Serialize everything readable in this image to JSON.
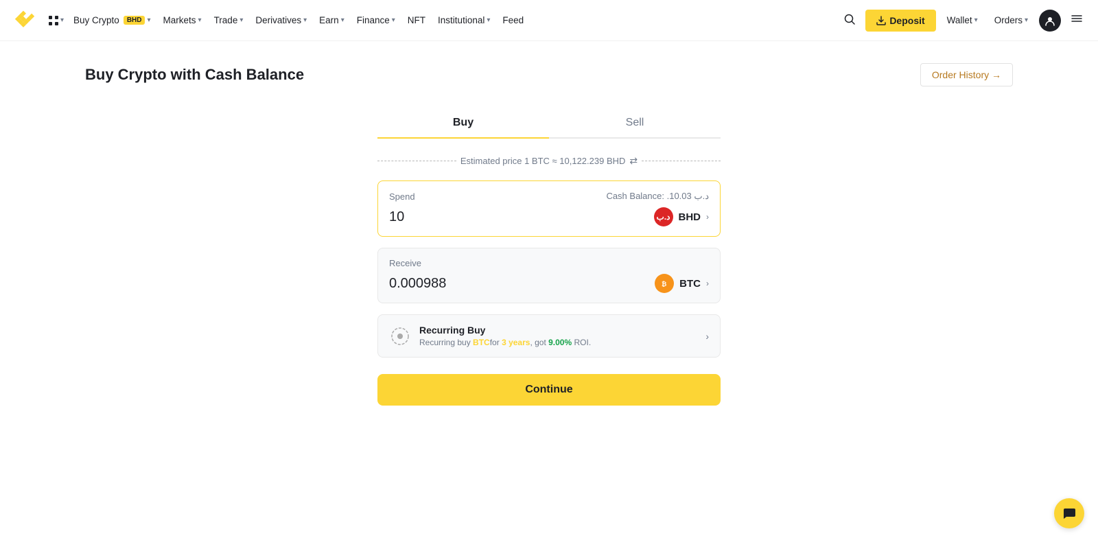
{
  "brand": {
    "name": "Binance"
  },
  "navbar": {
    "buy_crypto_label": "Buy Crypto",
    "buy_crypto_badge": "BHD",
    "markets_label": "Markets",
    "trade_label": "Trade",
    "derivatives_label": "Derivatives",
    "earn_label": "Earn",
    "finance_label": "Finance",
    "nft_label": "NFT",
    "institutional_label": "Institutional",
    "feed_label": "Feed",
    "deposit_label": "Deposit",
    "wallet_label": "Wallet",
    "orders_label": "Orders"
  },
  "page": {
    "title": "Buy Crypto with Cash Balance",
    "order_history_label": "Order History →"
  },
  "tabs": {
    "buy_label": "Buy",
    "sell_label": "Sell",
    "active": "buy"
  },
  "estimated_price": {
    "text": "Estimated price 1 BTC ≈ 10,122.239 BHD"
  },
  "spend": {
    "label": "Spend",
    "balance_label": "Cash Balance: .10.03 د.ب",
    "amount": "10",
    "currency": "BHD",
    "currency_symbol": "د.ب"
  },
  "receive": {
    "label": "Receive",
    "amount": "0.000988",
    "currency": "BTC"
  },
  "recurring": {
    "title": "Recurring Buy",
    "description_prefix": "Recurring buy ",
    "currency": "BTC",
    "duration_prefix": "for ",
    "duration": "3 years",
    "roi_prefix": ", got ",
    "roi": "9.00%",
    "roi_suffix": " ROI."
  },
  "continue_label": "Continue",
  "chat": {
    "icon": "💬"
  }
}
